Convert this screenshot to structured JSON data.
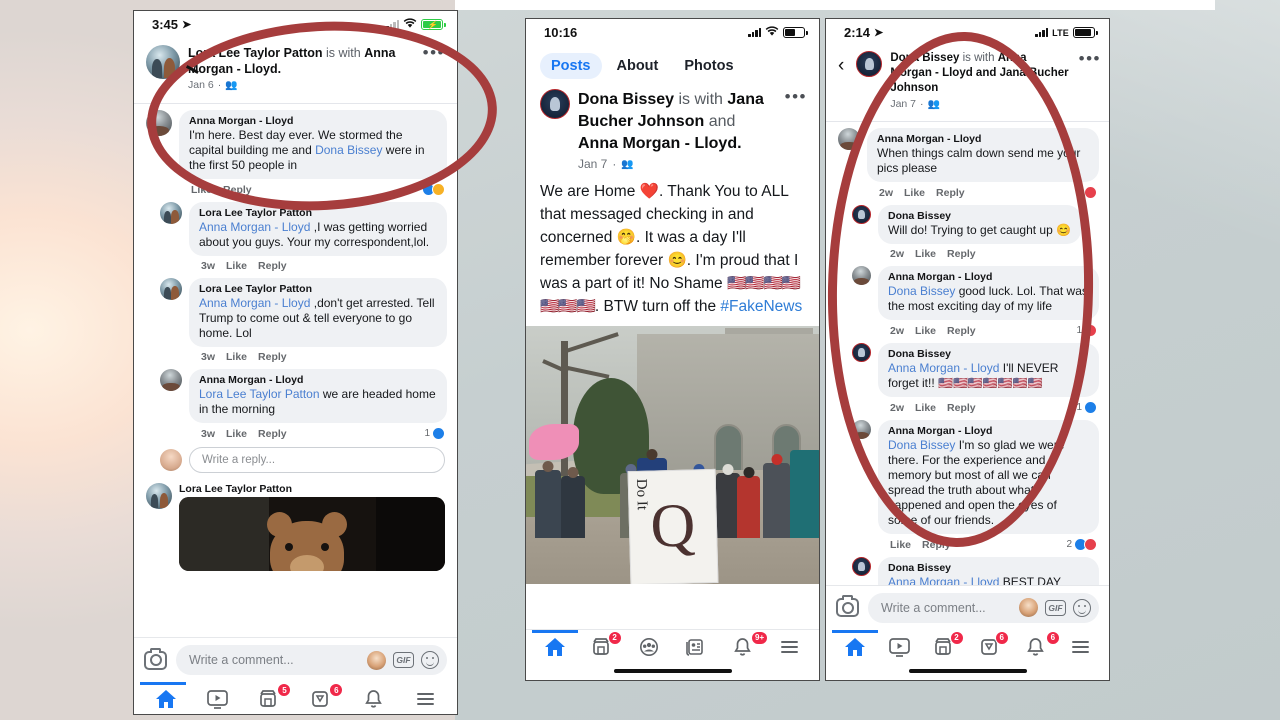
{
  "phone1": {
    "status": {
      "time": "3:45",
      "location_arrow": "location-arrow",
      "signal": "signal-bars",
      "wifi": "wifi-icon",
      "battery": "battery-charging"
    },
    "post": {
      "author": "Lora Lee Taylor Patton",
      "with_text": "is with",
      "tagged": "Anna Morgan - Lloyd.",
      "date": "Jan 6",
      "audience": "friends-icon",
      "menu": "•••"
    },
    "comments": [
      {
        "name": "Anna Morgan - Lloyd",
        "text": "I'm here. Best day ever. We stormed the capital building me and ",
        "mention": "Dona Bissey",
        "text_after": " were in the first 50 people in",
        "time": "",
        "like": "Like",
        "reply": "Reply",
        "react_count": ""
      },
      {
        "name": "Lora Lee Taylor Patton",
        "mention": "Anna Morgan - Lloyd",
        "text_after": " ,I was getting worried about you guys. Your my correspondent,lol.",
        "time": "3w",
        "like": "Like",
        "reply": "Reply",
        "react_count": ""
      },
      {
        "name": "Lora Lee Taylor Patton",
        "mention": "Anna Morgan - Lloyd",
        "text_after": " ,don't get arrested.  Tell Trump to come out & tell everyone to go home. Lol",
        "time": "3w",
        "like": "Like",
        "reply": "Reply",
        "react_count": ""
      },
      {
        "name": "Anna Morgan - Lloyd",
        "mention": "Lora Lee Taylor Patton",
        "text_after": " we are headed home in the morning",
        "time": "3w",
        "like": "Like",
        "reply": "Reply",
        "react_count": "1"
      }
    ],
    "reply_placeholder": "Write a reply...",
    "video_post_author": "Lora Lee Taylor Patton",
    "composer_placeholder": "Write a comment...",
    "tabbar": [
      {
        "name": "home",
        "badge": ""
      },
      {
        "name": "watch",
        "badge": ""
      },
      {
        "name": "marketplace",
        "badge": "5"
      },
      {
        "name": "groups",
        "badge": "6"
      },
      {
        "name": "notifications",
        "badge": ""
      },
      {
        "name": "menu",
        "badge": ""
      }
    ]
  },
  "phone2": {
    "status": {
      "time": "10:16",
      "signal": "signal-bars",
      "wifi": "wifi-icon",
      "battery": "battery"
    },
    "tabs": [
      {
        "label": "Posts",
        "active": true
      },
      {
        "label": "About",
        "active": false
      },
      {
        "label": "Photos",
        "active": false
      }
    ],
    "post": {
      "author": "Dona Bissey",
      "with_text": "is with",
      "tagged1": "Jana Bucher Johnson",
      "and_text": "and",
      "tagged2": "Anna Morgan - Lloyd.",
      "date": "Jan 7",
      "audience": "friends-icon",
      "menu": "•••",
      "body_part1": "We are Home ",
      "heart": "❤️",
      "body_part2": ". Thank You to ALL that messaged checking in and concerned ",
      "emoji1": "🤭",
      "body_part3": ". It was a day I'll remember forever ",
      "emoji2": "😊",
      "body_part4": ". I'm proud that I was a part of it! No Shame ",
      "flags": "🇺🇸🇺🇸🇺🇸🇺🇸🇺🇸🇺🇸🇺🇸",
      "body_part5": ". BTW turn off the ",
      "hashtag": "#FakeNews"
    },
    "photo": {
      "sign_letter": "Q",
      "sign_text": "Do It"
    },
    "tabbar": [
      {
        "name": "home",
        "badge": ""
      },
      {
        "name": "marketplace",
        "badge": "2"
      },
      {
        "name": "groups",
        "badge": ""
      },
      {
        "name": "news",
        "badge": ""
      },
      {
        "name": "notifications",
        "badge": "9+"
      },
      {
        "name": "menu",
        "badge": ""
      }
    ]
  },
  "phone3": {
    "status": {
      "time": "2:14",
      "location_arrow": "location-arrow",
      "signal": "signal-bars",
      "network": "LTE",
      "battery": "battery"
    },
    "back": "‹",
    "post": {
      "author": "Dona Bissey",
      "with_text": "is with",
      "tagged": "Anna Morgan - Lloyd and Jana Bucher Johnson",
      "date": "Jan 7",
      "audience": "friends-icon",
      "menu": "•••"
    },
    "comments": [
      {
        "name": "Anna Morgan - Lloyd",
        "mention": "",
        "text_after": "When things calm down send me your pics please",
        "time": "2w",
        "like": "Like",
        "reply": "Reply",
        "react_count": "1",
        "react_type": "love"
      },
      {
        "name": "Dona Bissey",
        "mention": "",
        "text_after": "Will do! Trying to get caught up 😊",
        "time": "2w",
        "like": "Like",
        "reply": "Reply",
        "react_count": "",
        "react_type": ""
      },
      {
        "name": "Anna Morgan - Lloyd",
        "mention": "Dona Bissey",
        "text_after": " good luck. Lol. That was the most exciting day of my life",
        "time": "2w",
        "like": "Like",
        "reply": "Reply",
        "react_count": "1",
        "react_type": "love"
      },
      {
        "name": "Dona Bissey",
        "mention": "Anna Morgan - Lloyd",
        "text_after": " I'll NEVER forget it!! 🇺🇸🇺🇸🇺🇸🇺🇸🇺🇸🇺🇸🇺🇸",
        "time": "2w",
        "like": "Like",
        "reply": "Reply",
        "react_count": "1",
        "react_type": "like"
      },
      {
        "name": "Anna Morgan - Lloyd",
        "mention": "Dona Bissey",
        "text_after": " I'm so glad we were there. For the experience and memory but most of all we can spread the truth about what happened and open the eyes of some of our friends.",
        "time": "",
        "like": "Like",
        "reply": "Reply",
        "react_count": "2",
        "react_type": "like-love"
      },
      {
        "name": "Dona Bissey",
        "mention": "Anna Morgan - Lloyd",
        "text_after": " BEST DAY EVER",
        "time": "",
        "like": "",
        "reply": "",
        "react_count": "",
        "react_type": ""
      }
    ],
    "composer_placeholder": "Write a comment...",
    "tabbar": [
      {
        "name": "home",
        "badge": ""
      },
      {
        "name": "watch",
        "badge": ""
      },
      {
        "name": "marketplace",
        "badge": "2"
      },
      {
        "name": "groups",
        "badge": "6"
      },
      {
        "name": "notifications",
        "badge": "6"
      },
      {
        "name": "menu",
        "badge": ""
      }
    ]
  },
  "annotations": {
    "circle_color": "#a63d3d",
    "circle_1": "highlight-ellipse-post-and-first-comment",
    "circle_2": "highlight-ellipse-comment-thread"
  },
  "colors": {
    "facebook_blue": "#1877f2",
    "mention_blue": "#4a7fd0",
    "badge_red": "#f02849",
    "bubble_gray": "#eff1f4",
    "annotation_red": "#a63d3d"
  }
}
